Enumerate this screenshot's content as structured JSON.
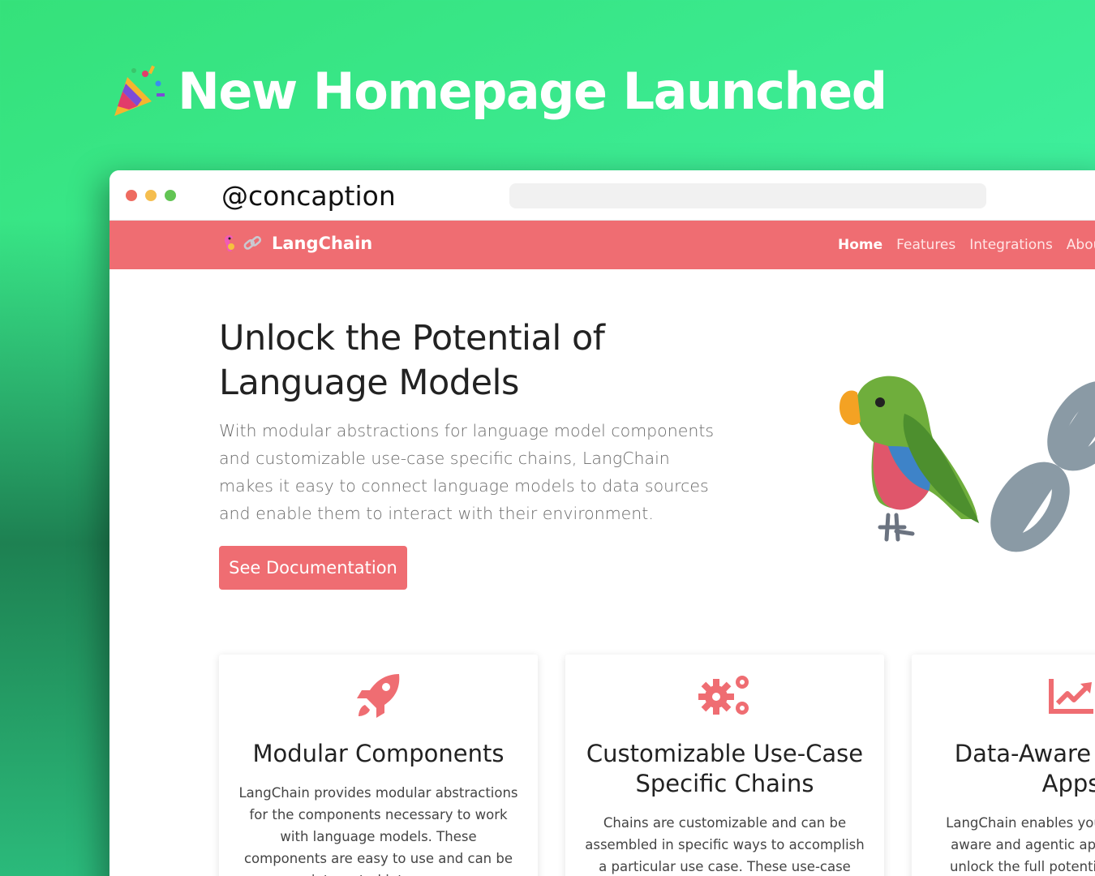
{
  "banner": {
    "title": "New Homepage Launched",
    "icon": "party-popper-icon"
  },
  "window": {
    "handle": "@concaption",
    "dots": [
      "#ee6b60",
      "#f5be4f",
      "#62c554"
    ]
  },
  "navbar": {
    "brand": "LangChain",
    "links": [
      {
        "label": "Home",
        "active": true
      },
      {
        "label": "Features",
        "active": false
      },
      {
        "label": "Integrations",
        "active": false
      },
      {
        "label": "About",
        "active": false
      }
    ]
  },
  "hero": {
    "title_line1": "Unlock the Potential of",
    "title_line2": "Language Models",
    "description": "With modular abstractions for language model components and customizable use-case specific chains, LangChain makes it easy to connect language models to data sources and enable them to interact with their environment.",
    "cta_label": "See Documentation"
  },
  "features": [
    {
      "icon": "rocket-icon",
      "title": "Modular Components",
      "body": "LangChain provides modular abstractions for the components necessary to work with language models. These components are easy to use and can be integrated into your"
    },
    {
      "icon": "gears-icon",
      "title": "Customizable Use-Case Specific Chains",
      "body": "Chains are customizable and can be assembled in specific ways to accomplish a particular use case. These use-case specific"
    },
    {
      "icon": "chart-line-icon",
      "title": "Data-Aware Agentic Apps",
      "body": "LangChain enables you to build data-aware and agentic applications that unlock the full potential of language models"
    }
  ],
  "colors": {
    "accent": "#ef6d72",
    "background": "#3ff0a0"
  }
}
